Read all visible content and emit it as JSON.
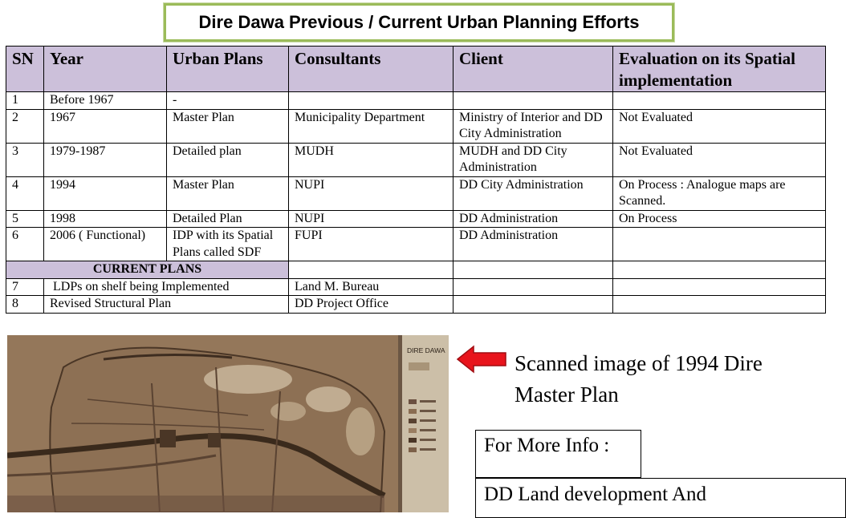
{
  "title": "Dire Dawa Previous / Current Urban Planning Efforts",
  "table": {
    "headers": [
      "SN",
      "Year",
      "Urban Plans",
      "Consultants",
      "Client",
      "Evaluation on its Spatial implementation"
    ],
    "rows": [
      {
        "sn": "1",
        "year": "Before 1967",
        "plan": "-",
        "consultant": "",
        "client": "",
        "evaluation": ""
      },
      {
        "sn": "2",
        "year": "1967",
        "plan": "Master Plan",
        "consultant": "Municipality Department",
        "client": "Ministry of Interior and DD City Administration",
        "evaluation": "Not Evaluated"
      },
      {
        "sn": "3",
        "year": "1979-1987",
        "plan": "Detailed plan",
        "consultant": "MUDH",
        "client": "MUDH and DD City Administration",
        "evaluation": "Not Evaluated"
      },
      {
        "sn": "4",
        "year": "1994",
        "plan": "Master Plan",
        "consultant": "NUPI",
        "client": "DD City Administration",
        "evaluation": "On Process : Analogue maps are Scanned."
      },
      {
        "sn": "5",
        "year": "1998",
        "plan": "Detailed Plan",
        "consultant": "NUPI",
        "client": "DD Administration",
        "evaluation": "On Process"
      },
      {
        "sn": "6",
        "year": "2006 ( Functional)",
        "plan": "IDP with its Spatial Plans called SDF",
        "consultant": "FUPI",
        "client": "DD Administration",
        "evaluation": ""
      }
    ],
    "current_label": "CURRENT PLANS",
    "current_rows": [
      {
        "sn": "7",
        "item": "LDPs on shelf being Implemented",
        "consultant": "Land M. Bureau"
      },
      {
        "sn": "8",
        "item": "Revised Structural Plan",
        "consultant": "DD Project Office"
      }
    ]
  },
  "map_title": "DIRE DAWA",
  "caption": "Scanned image of 1994 Dire Master Plan",
  "info_label": "For More Info :",
  "dept_text": "DD Land development  And",
  "colors": {
    "header_bg": "#ccc0da",
    "title_border": "#9bbb59",
    "arrow": "#e8141c"
  }
}
